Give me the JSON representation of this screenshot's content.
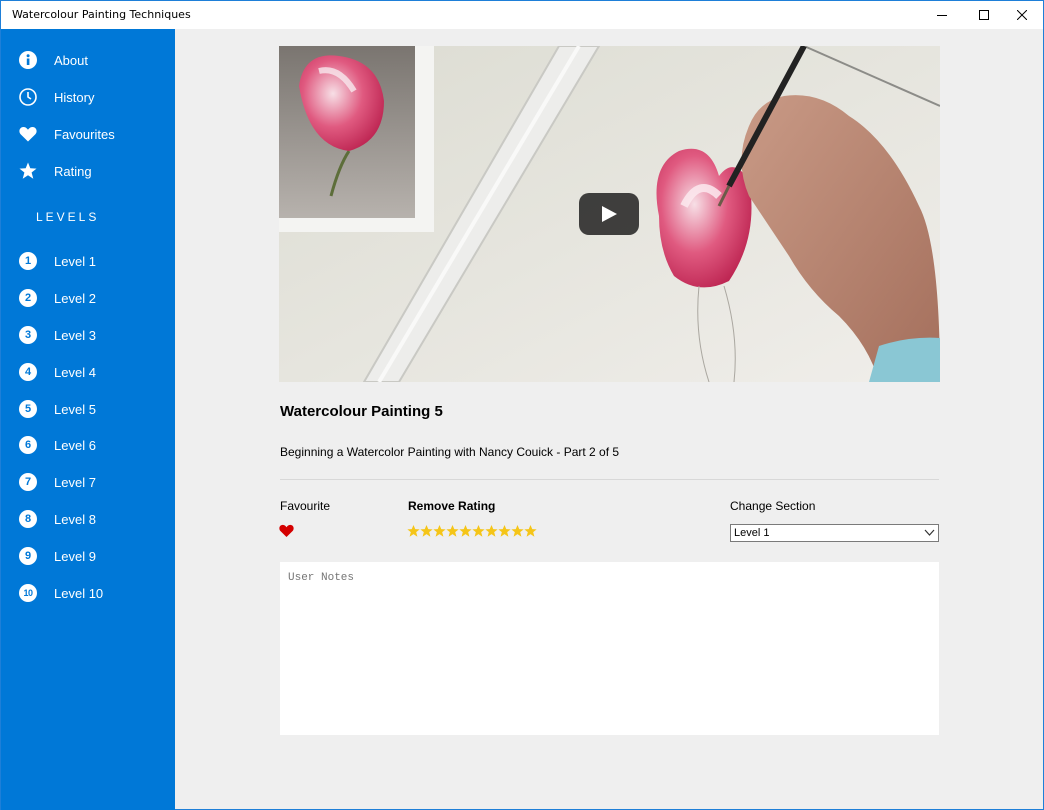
{
  "window": {
    "title": "Watercolour Painting Techniques"
  },
  "sidebar": {
    "items": [
      {
        "label": "About",
        "icon": "info-icon"
      },
      {
        "label": "History",
        "icon": "clock-icon"
      },
      {
        "label": "Favourites",
        "icon": "heart-icon"
      },
      {
        "label": "Rating",
        "icon": "star-icon"
      }
    ],
    "levels_header": "LEVELS",
    "levels": [
      {
        "number": "1",
        "label": "Level 1"
      },
      {
        "number": "2",
        "label": "Level 2"
      },
      {
        "number": "3",
        "label": "Level 3"
      },
      {
        "number": "4",
        "label": "Level 4"
      },
      {
        "number": "5",
        "label": "Level 5"
      },
      {
        "number": "6",
        "label": "Level 6"
      },
      {
        "number": "7",
        "label": "Level 7"
      },
      {
        "number": "8",
        "label": "Level 8"
      },
      {
        "number": "9",
        "label": "Level 9"
      },
      {
        "number": "10",
        "label": "Level 10"
      }
    ]
  },
  "main": {
    "video_title": "Watercolour Painting 5",
    "video_description": "Beginning a Watercolor Painting with Nancy Couick - Part 2 of 5",
    "favourite_label": "Favourite",
    "favourite_active": true,
    "rating_label": "Remove Rating",
    "rating_stars": 10,
    "section_label": "Change Section",
    "section_selected": "Level 1",
    "notes_placeholder": "User Notes"
  },
  "colors": {
    "sidebar": "#0078d7",
    "heart": "#d40000",
    "star": "#f5c518",
    "content_bg": "#efefef"
  }
}
